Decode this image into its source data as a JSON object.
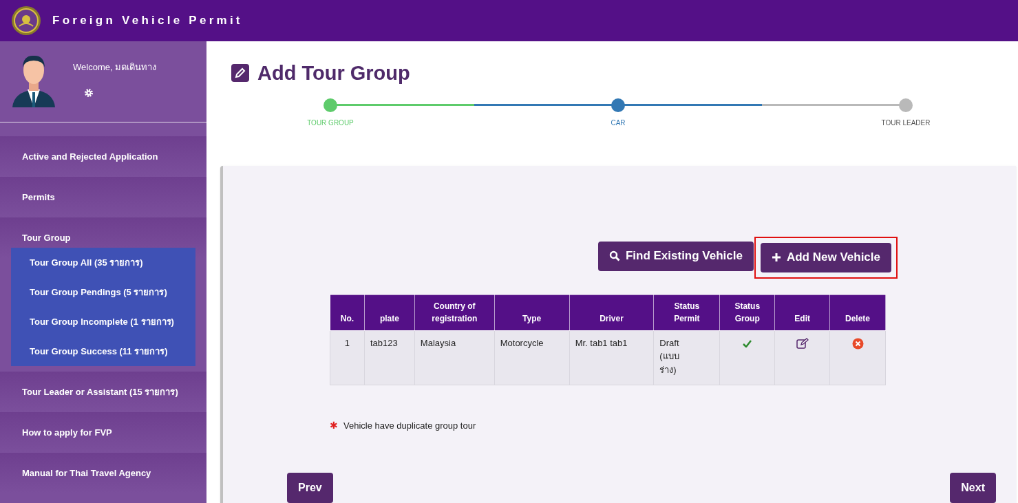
{
  "header": {
    "title": "Foreign Vehicle Permit"
  },
  "user": {
    "welcome": "Welcome, มดเดินทาง"
  },
  "sidebar": {
    "items": [
      {
        "label": "Active and Rejected Application"
      },
      {
        "label": "Permits"
      },
      {
        "label": "Tour Group",
        "children": [
          {
            "label": "Tour Group All (35 รายการ)"
          },
          {
            "label": "Tour Group Pendings (5 รายการ)"
          },
          {
            "label": "Tour Group Incomplete (1 รายการ)"
          },
          {
            "label": "Tour Group Success (11 รายการ)"
          }
        ]
      },
      {
        "label": "Tour Leader or Assistant (15 รายการ)"
      },
      {
        "label": "How to apply for FVP"
      },
      {
        "label": "Manual for Thai Travel Agency"
      }
    ]
  },
  "page": {
    "title": "Add Tour Group"
  },
  "steps": [
    {
      "label": "TOUR GROUP",
      "done": true,
      "current": false
    },
    {
      "label": "CAR",
      "done": false,
      "current": true
    },
    {
      "label": "TOUR LEADER",
      "done": false,
      "current": false
    }
  ],
  "actions": [
    {
      "label": "Find Existing Vehicle",
      "kind": "search"
    },
    {
      "label": "Add New Vehicle",
      "kind": "add",
      "highlighted": true
    }
  ],
  "table": {
    "columns": [
      "No.",
      "plate",
      "Country of registration",
      "Type",
      "Driver",
      "Status Permit",
      "Status Group",
      "Edit",
      "Delete"
    ],
    "rows": [
      {
        "no": "1",
        "plate": "tab123",
        "country": "Malaysia",
        "type": "Motorcycle",
        "driver": "Mr. tab1 tab1",
        "status_permit": "Draft (แบบร่าง)",
        "group_ok": true
      }
    ]
  },
  "note": {
    "mark": "✱",
    "text": "Vehicle have duplicate group tour"
  },
  "nav": {
    "prev": "Prev",
    "next": "Next"
  }
}
